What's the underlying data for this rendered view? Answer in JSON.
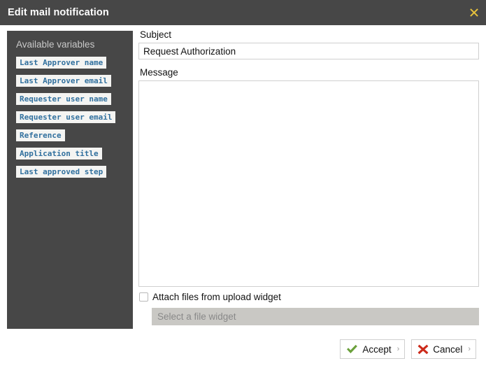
{
  "window": {
    "title": "Edit mail notification",
    "close_icon": "close-x-icon",
    "close_color": "#e8c33c",
    "titlebar_color": "#474747"
  },
  "sidebar": {
    "title": "Available variables",
    "panel_color": "#474747",
    "chip_bg": "#f4f4f2",
    "chip_text_color": "#31709e",
    "variables": [
      {
        "label": "Last Approver name"
      },
      {
        "label": "Last Approver email"
      },
      {
        "label": "Requester user name"
      },
      {
        "label": "Requester user email"
      },
      {
        "label": "Reference"
      },
      {
        "label": "Application title"
      },
      {
        "label": "Last approved step"
      }
    ]
  },
  "form": {
    "subject": {
      "label": "Subject",
      "value": "Request Authorization",
      "placeholder": ""
    },
    "message": {
      "label": "Message",
      "value": "",
      "placeholder": ""
    },
    "attach": {
      "label": "Attach files from upload widget",
      "checked": false
    },
    "file_widget": {
      "selected": "Select a file widget",
      "disabled": true
    }
  },
  "footer": {
    "accept": {
      "label": "Accept",
      "icon": "check-icon",
      "icon_color": "#6aa03a",
      "chevron": "›"
    },
    "cancel": {
      "label": "Cancel",
      "icon": "cross-icon",
      "icon_color": "#cc2a1a",
      "chevron": "›"
    }
  }
}
